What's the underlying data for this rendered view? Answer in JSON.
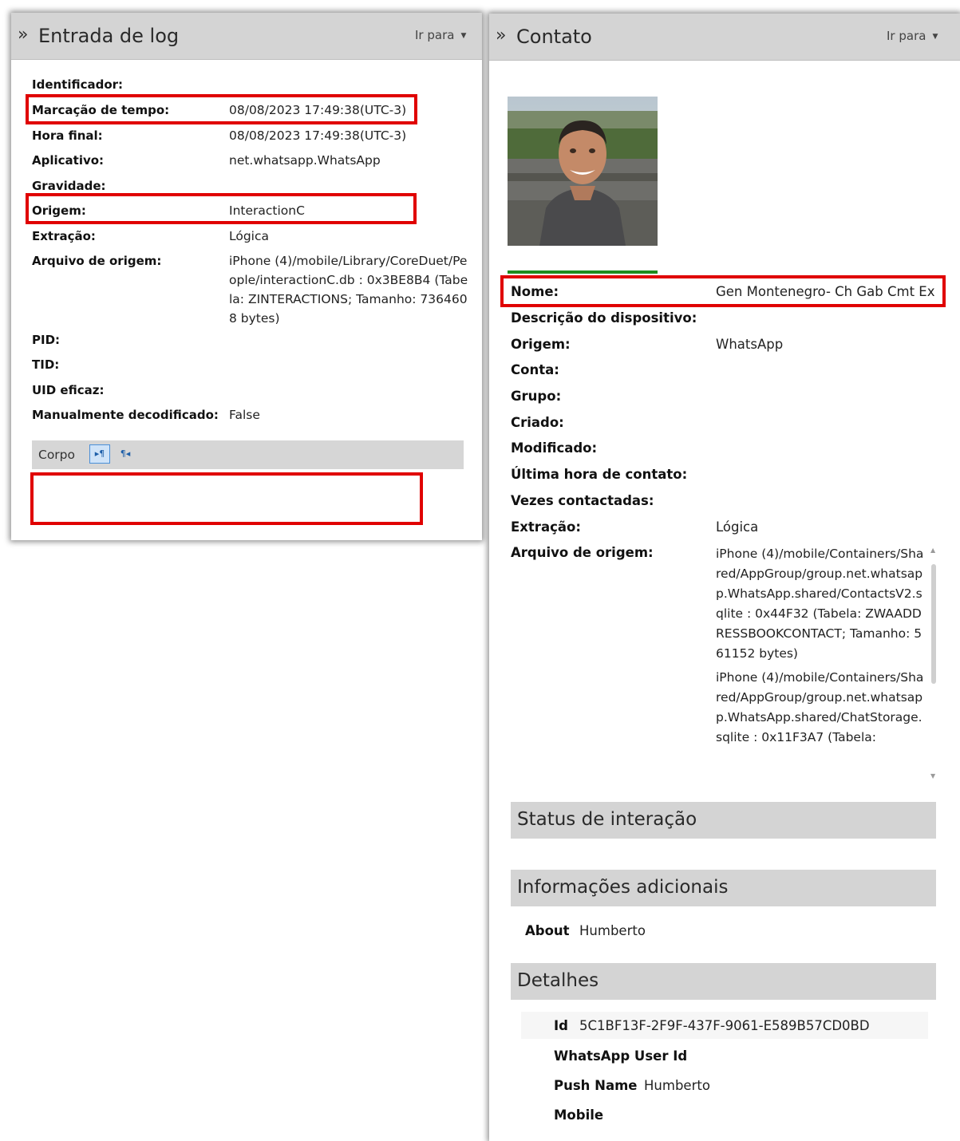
{
  "log_panel": {
    "title": "Entrada de log",
    "goto_label": "Ir para",
    "fields": {
      "identificador": {
        "label": "Identificador:",
        "value": ""
      },
      "marcacao_tempo": {
        "label": "Marcação de tempo:",
        "value": "08/08/2023 17:49:38(UTC-3)"
      },
      "hora_final": {
        "label": "Hora final:",
        "value": "08/08/2023 17:49:38(UTC-3)"
      },
      "aplicativo": {
        "label": "Aplicativo:",
        "value": "net.whatsapp.WhatsApp"
      },
      "gravidade": {
        "label": "Gravidade:",
        "value": ""
      },
      "origem": {
        "label": "Origem:",
        "value": "InteractionC"
      },
      "extracao": {
        "label": "Extração:",
        "value": "Lógica"
      },
      "arquivo_origem": {
        "label": "Arquivo de origem:",
        "value": "iPhone (4)/mobile/Library/CoreDuet/People/interactionC.db : 0x3BE8B4 (Tabela: ZINTERACTIONS; Tamanho: 7364608 bytes)"
      },
      "pid": {
        "label": "PID:",
        "value": ""
      },
      "tid": {
        "label": "TID:",
        "value": ""
      },
      "uid_eficaz": {
        "label": "UID eficaz:",
        "value": ""
      },
      "manualmente_decodificado": {
        "label": "Manualmente decodificado:",
        "value": "False"
      }
    },
    "corpo": {
      "label": "Corpo",
      "ltr_icon": "▸¶",
      "rtl_icon": "¶◂"
    }
  },
  "contact_panel": {
    "title": "Contato",
    "goto_label": "Ir para",
    "fields": {
      "nome": {
        "label": "Nome:",
        "value": "Gen Montenegro- Ch Gab Cmt Ex"
      },
      "descricao_dispositivo": {
        "label": "Descrição do dispositivo:",
        "value": ""
      },
      "origem": {
        "label": "Origem:",
        "value": "WhatsApp"
      },
      "conta": {
        "label": "Conta:",
        "value": ""
      },
      "grupo": {
        "label": "Grupo:",
        "value": ""
      },
      "criado": {
        "label": "Criado:",
        "value": ""
      },
      "modificado": {
        "label": "Modificado:",
        "value": ""
      },
      "ultima_hora_contato": {
        "label": "Última hora de contato:",
        "value": ""
      },
      "vezes_contactadas": {
        "label": "Vezes contactadas:",
        "value": ""
      },
      "extracao": {
        "label": "Extração:",
        "value": "Lógica"
      },
      "arquivo_origem": {
        "label": "Arquivo de origem:",
        "values": [
          "iPhone (4)/mobile/Containers/Shared/AppGroup/group.net.whatsapp.WhatsApp.shared/ContactsV2.sqlite : 0x44F32 (Tabela: ZWAADDRESSBOOKCONTACT; Tamanho: 561152 bytes)",
          "iPhone (4)/mobile/Containers/Shared/AppGroup/group.net.whatsapp.WhatsApp.shared/ChatStorage.sqlite : 0x11F3A7 (Tabela:"
        ]
      }
    },
    "sections": {
      "status_interacao": "Status de interação",
      "informacoes_adicionais": "Informações adicionais",
      "detalhes": "Detalhes"
    },
    "additional_info": {
      "about_label": "About",
      "about_value": "Humberto"
    },
    "details": {
      "id_label": "Id",
      "id_value": "5C1BF13F-2F9F-437F-9061-E589B57CD0BD",
      "whatsapp_user_id_label": "WhatsApp User Id",
      "whatsapp_user_id_value": "",
      "push_name_label": "Push Name",
      "push_name_value": "Humberto",
      "mobile_label": "Mobile",
      "mobile_value": ""
    }
  },
  "icons": {
    "chevron": "»",
    "dropdown_caret": "▼",
    "scroll_up": "▲",
    "scroll_down": "▼"
  },
  "colors": {
    "highlight_box": "#e00000",
    "header_bg": "#d4d4d4",
    "photo_underline": "#1e8c1e"
  }
}
